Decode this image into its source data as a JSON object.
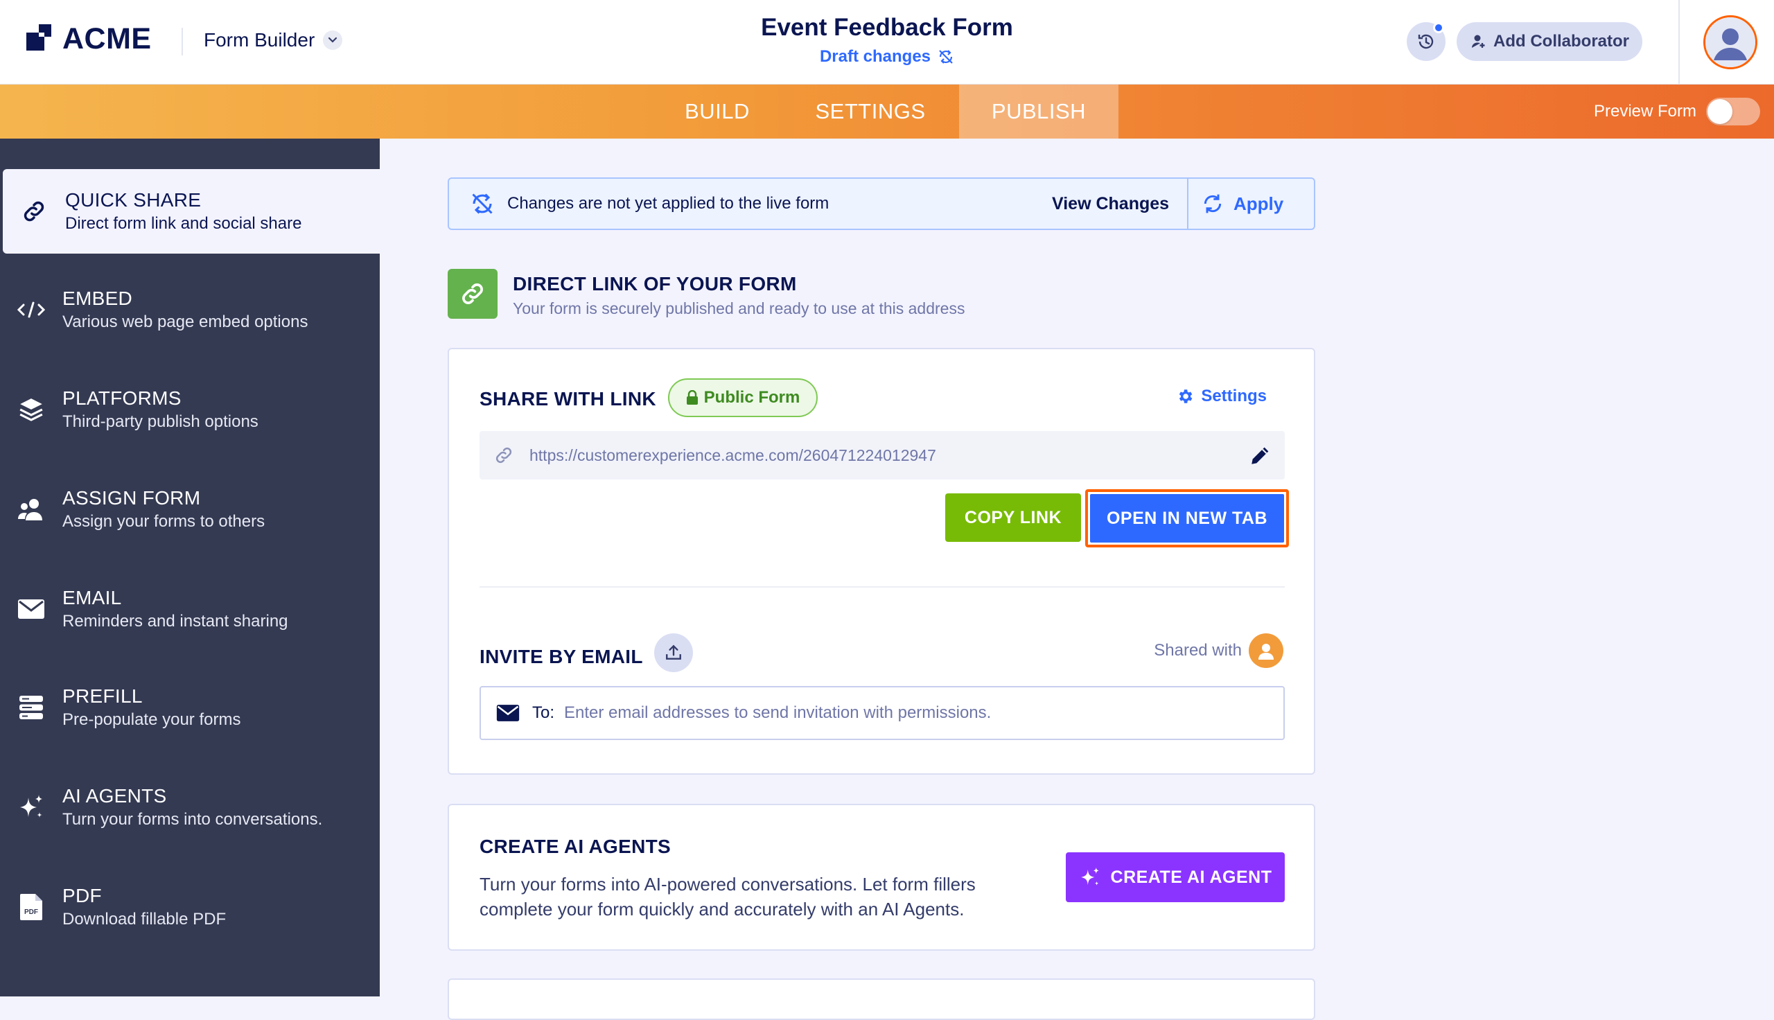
{
  "header": {
    "logo_text": "ACME",
    "builder_label": "Form Builder",
    "form_title": "Event Feedback Form",
    "draft_label": "Draft changes",
    "collaborator_label": "Add Collaborator"
  },
  "nav": {
    "tabs": [
      {
        "label": "BUILD"
      },
      {
        "label": "SETTINGS"
      },
      {
        "label": "PUBLISH",
        "active": true
      }
    ],
    "preview_label": "Preview Form",
    "preview_on": false
  },
  "sidebar": {
    "items": [
      {
        "title": "QUICK SHARE",
        "subtitle": "Direct form link and social share",
        "icon": "link-icon",
        "active": true
      },
      {
        "title": "EMBED",
        "subtitle": "Various web page embed options",
        "icon": "code-icon"
      },
      {
        "title": "PLATFORMS",
        "subtitle": "Third-party publish options",
        "icon": "layers-icon"
      },
      {
        "title": "ASSIGN FORM",
        "subtitle": "Assign your forms to others",
        "icon": "users-icon"
      },
      {
        "title": "EMAIL",
        "subtitle": "Reminders and instant sharing",
        "icon": "envelope-icon"
      },
      {
        "title": "PREFILL",
        "subtitle": "Pre-populate your forms",
        "icon": "prefill-icon"
      },
      {
        "title": "AI AGENTS",
        "subtitle": "Turn your forms into conversations.",
        "icon": "sparkle-icon"
      },
      {
        "title": "PDF",
        "subtitle": "Download fillable PDF",
        "icon": "pdf-icon"
      }
    ]
  },
  "banner": {
    "message": "Changes are not yet applied to the live form",
    "view_changes_label": "View Changes",
    "apply_label": "Apply"
  },
  "direct_link": {
    "title": "DIRECT LINK OF YOUR FORM",
    "subtitle": "Your form is securely published and ready to use at this address"
  },
  "share": {
    "title": "SHARE WITH LINK",
    "badge_label": "Public Form",
    "settings_label": "Settings",
    "url": "https://customerexperience.acme.com/260471224012947",
    "copy_label": "COPY LINK",
    "open_label": "OPEN IN NEW TAB"
  },
  "invite": {
    "title": "INVITE BY EMAIL",
    "shared_with_label": "Shared with",
    "to_label": "To:",
    "placeholder": "Enter email addresses to send invitation with permissions."
  },
  "ai_agents": {
    "title": "CREATE AI AGENTS",
    "description": "Turn your forms into AI-powered conversations. Let form fillers complete your form quickly and accurately with an AI Agents.",
    "button_label": "CREATE AI AGENT"
  },
  "colors": {
    "accent_blue": "#2e69ff",
    "highlight_orange": "#ff6100",
    "copy_green": "#78bb07",
    "ai_purple": "#8b34ff",
    "sidebar_bg": "#343a52"
  }
}
